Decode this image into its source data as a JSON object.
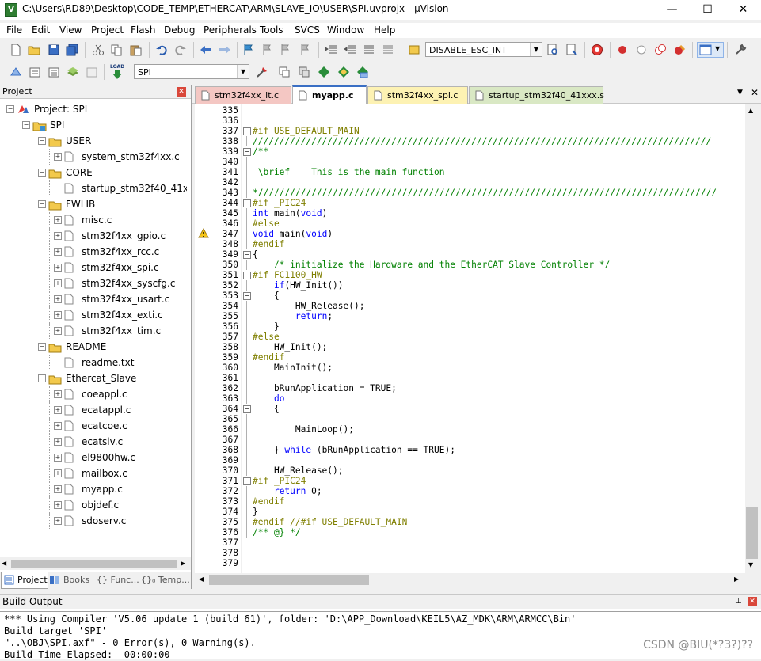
{
  "window": {
    "title": "C:\\Users\\RD89\\Desktop\\CODE_TEMP\\ETHERCAT\\ARM\\SLAVE_IO\\USER\\SPI.uvprojx - µVision",
    "app_icon_letter": "V",
    "controls": {
      "minimize": "—",
      "maximize": "☐",
      "close": "✕"
    }
  },
  "menu": [
    "File",
    "Edit",
    "View",
    "Project",
    "Flash",
    "Debug",
    "Peripherals",
    "Tools",
    "SVCS",
    "Window",
    "Help"
  ],
  "toolbar": {
    "define_combo": "DISABLE_ESC_INT",
    "target_combo": "SPI",
    "load_label": "LOAD"
  },
  "project_panel": {
    "header": "Project",
    "pin": "📌",
    "close": "✕",
    "tree": [
      {
        "label": "Project: SPI",
        "level": 0,
        "kind": "project",
        "exp": "−"
      },
      {
        "label": "SPI",
        "level": 1,
        "kind": "target",
        "exp": "−"
      },
      {
        "label": "USER",
        "level": 2,
        "kind": "folder",
        "exp": "−"
      },
      {
        "label": "system_stm32f4xx.c",
        "level": 3,
        "kind": "file",
        "exp": "+"
      },
      {
        "label": "CORE",
        "level": 2,
        "kind": "folder",
        "exp": "−"
      },
      {
        "label": "startup_stm32f40_41xxx.s",
        "level": 3,
        "kind": "file",
        "exp": ""
      },
      {
        "label": "FWLIB",
        "level": 2,
        "kind": "folder",
        "exp": "−"
      },
      {
        "label": "misc.c",
        "level": 3,
        "kind": "file",
        "exp": "+"
      },
      {
        "label": "stm32f4xx_gpio.c",
        "level": 3,
        "kind": "file",
        "exp": "+"
      },
      {
        "label": "stm32f4xx_rcc.c",
        "level": 3,
        "kind": "file",
        "exp": "+"
      },
      {
        "label": "stm32f4xx_spi.c",
        "level": 3,
        "kind": "file",
        "exp": "+"
      },
      {
        "label": "stm32f4xx_syscfg.c",
        "level": 3,
        "kind": "file",
        "exp": "+"
      },
      {
        "label": "stm32f4xx_usart.c",
        "level": 3,
        "kind": "file",
        "exp": "+"
      },
      {
        "label": "stm32f4xx_exti.c",
        "level": 3,
        "kind": "file",
        "exp": "+"
      },
      {
        "label": "stm32f4xx_tim.c",
        "level": 3,
        "kind": "file",
        "exp": "+"
      },
      {
        "label": "README",
        "level": 2,
        "kind": "folder",
        "exp": "−"
      },
      {
        "label": "readme.txt",
        "level": 3,
        "kind": "file",
        "exp": ""
      },
      {
        "label": "Ethercat_Slave",
        "level": 2,
        "kind": "folder",
        "exp": "−"
      },
      {
        "label": "coeappl.c",
        "level": 3,
        "kind": "file",
        "exp": "+"
      },
      {
        "label": "ecatappl.c",
        "level": 3,
        "kind": "file",
        "exp": "+"
      },
      {
        "label": "ecatcoe.c",
        "level": 3,
        "kind": "file",
        "exp": "+"
      },
      {
        "label": "ecatslv.c",
        "level": 3,
        "kind": "file",
        "exp": "+"
      },
      {
        "label": "el9800hw.c",
        "level": 3,
        "kind": "file",
        "exp": "+"
      },
      {
        "label": "mailbox.c",
        "level": 3,
        "kind": "file",
        "exp": "+"
      },
      {
        "label": "myapp.c",
        "level": 3,
        "kind": "file",
        "exp": "+"
      },
      {
        "label": "objdef.c",
        "level": 3,
        "kind": "file",
        "exp": "+"
      },
      {
        "label": "sdoserv.c",
        "level": 3,
        "kind": "file",
        "exp": "+"
      }
    ],
    "bottom_tabs": [
      "Project",
      "Books",
      "{} Func...",
      "{}₀ Temp..."
    ]
  },
  "editor": {
    "tabs": [
      {
        "label": "stm32f4xx_it.c",
        "color": "#f4c7c3",
        "active": false
      },
      {
        "label": "myapp.c",
        "color": "#ffffff",
        "active": true
      },
      {
        "label": "stm32f4xx_spi.c",
        "color": "#fdf2b3",
        "active": false
      },
      {
        "label": "startup_stm32f40_41xxx.s",
        "color": "#d9e8c4",
        "active": false
      }
    ],
    "first_line": 335,
    "warning_line": 347,
    "lines": [
      {
        "n": "335",
        "fold": "",
        "spans": []
      },
      {
        "n": "336",
        "fold": "",
        "spans": []
      },
      {
        "n": "337",
        "fold": "−",
        "spans": [
          [
            "pp",
            "#if USE_DEFAULT_MAIN"
          ]
        ]
      },
      {
        "n": "338",
        "fold": "",
        "spans": [
          [
            "cm",
            "//////////////////////////////////////////////////////////////////////////////////////"
          ]
        ]
      },
      {
        "n": "339",
        "fold": "−",
        "spans": [
          [
            "cm",
            "/**"
          ]
        ]
      },
      {
        "n": "340",
        "fold": "",
        "spans": []
      },
      {
        "n": "341",
        "fold": "",
        "spans": [
          [
            "cm",
            " \\brief    This is the main function"
          ]
        ]
      },
      {
        "n": "342",
        "fold": "",
        "spans": []
      },
      {
        "n": "343",
        "fold": "",
        "spans": [
          [
            "cm",
            "*//////////////////////////////////////////////////////////////////////////////////////"
          ]
        ]
      },
      {
        "n": "344",
        "fold": "−",
        "spans": [
          [
            "pp",
            "#if _PIC24"
          ]
        ]
      },
      {
        "n": "345",
        "fold": "",
        "spans": [
          [
            "kw",
            "int"
          ],
          [
            "brk",
            " main("
          ],
          [
            "kw",
            "void"
          ],
          [
            "brk",
            ")"
          ]
        ]
      },
      {
        "n": "346",
        "fold": "",
        "spans": [
          [
            "pp",
            "#else"
          ]
        ]
      },
      {
        "n": "347",
        "fold": "",
        "spans": [
          [
            "kw",
            "void"
          ],
          [
            "brk",
            " main("
          ],
          [
            "kw",
            "void"
          ],
          [
            "brk",
            ")"
          ]
        ]
      },
      {
        "n": "348",
        "fold": "",
        "spans": [
          [
            "pp",
            "#endif"
          ]
        ]
      },
      {
        "n": "349",
        "fold": "−",
        "spans": [
          [
            "brk",
            "{"
          ]
        ]
      },
      {
        "n": "350",
        "fold": "",
        "spans": [
          [
            "cm",
            "    /* initialize the Hardware and the EtherCAT Slave Controller */"
          ]
        ]
      },
      {
        "n": "351",
        "fold": "−",
        "spans": [
          [
            "pp",
            "#if FC1100_HW"
          ]
        ]
      },
      {
        "n": "352",
        "fold": "",
        "spans": [
          [
            "brk",
            "    "
          ],
          [
            "kw",
            "if"
          ],
          [
            "brk",
            "(HW_Init())"
          ]
        ]
      },
      {
        "n": "353",
        "fold": "−",
        "spans": [
          [
            "brk",
            "    {"
          ]
        ]
      },
      {
        "n": "354",
        "fold": "",
        "spans": [
          [
            "brk",
            "        HW_Release();"
          ]
        ]
      },
      {
        "n": "355",
        "fold": "",
        "spans": [
          [
            "brk",
            "        "
          ],
          [
            "kw",
            "return"
          ],
          [
            "brk",
            ";"
          ]
        ]
      },
      {
        "n": "356",
        "fold": "",
        "spans": [
          [
            "brk",
            "    }"
          ]
        ]
      },
      {
        "n": "357",
        "fold": "",
        "spans": [
          [
            "pp",
            "#else"
          ]
        ]
      },
      {
        "n": "358",
        "fold": "",
        "spans": [
          [
            "brk",
            "    HW_Init();"
          ]
        ]
      },
      {
        "n": "359",
        "fold": "",
        "spans": [
          [
            "pp",
            "#endif"
          ]
        ]
      },
      {
        "n": "360",
        "fold": "",
        "spans": [
          [
            "brk",
            "    MainInit();"
          ]
        ]
      },
      {
        "n": "361",
        "fold": "",
        "spans": []
      },
      {
        "n": "362",
        "fold": "",
        "spans": [
          [
            "brk",
            "    bRunApplication = TRUE;"
          ]
        ]
      },
      {
        "n": "363",
        "fold": "",
        "spans": [
          [
            "brk",
            "    "
          ],
          [
            "kw",
            "do"
          ]
        ]
      },
      {
        "n": "364",
        "fold": "−",
        "spans": [
          [
            "brk",
            "    {"
          ]
        ]
      },
      {
        "n": "365",
        "fold": "",
        "spans": []
      },
      {
        "n": "366",
        "fold": "",
        "spans": [
          [
            "brk",
            "        MainLoop();"
          ]
        ]
      },
      {
        "n": "367",
        "fold": "",
        "spans": []
      },
      {
        "n": "368",
        "fold": "",
        "spans": [
          [
            "brk",
            "    } "
          ],
          [
            "kw",
            "while"
          ],
          [
            "brk",
            " (bRunApplication == TRUE);"
          ]
        ]
      },
      {
        "n": "369",
        "fold": "",
        "spans": []
      },
      {
        "n": "370",
        "fold": "",
        "spans": [
          [
            "brk",
            "    HW_Release();"
          ]
        ]
      },
      {
        "n": "371",
        "fold": "−",
        "spans": [
          [
            "pp",
            "#if _PIC24"
          ]
        ]
      },
      {
        "n": "372",
        "fold": "",
        "spans": [
          [
            "brk",
            "    "
          ],
          [
            "kw",
            "return"
          ],
          [
            "brk",
            " 0;"
          ]
        ]
      },
      {
        "n": "373",
        "fold": "",
        "spans": [
          [
            "pp",
            "#endif"
          ]
        ]
      },
      {
        "n": "374",
        "fold": "",
        "spans": [
          [
            "brk",
            "}"
          ]
        ]
      },
      {
        "n": "375",
        "fold": "",
        "spans": [
          [
            "pp",
            "#endif //#if USE_DEFAULT_MAIN"
          ]
        ]
      },
      {
        "n": "376",
        "fold": "",
        "spans": [
          [
            "cm",
            "/** @} */"
          ]
        ]
      },
      {
        "n": "377",
        "fold": "",
        "spans": []
      },
      {
        "n": "378",
        "fold": "",
        "spans": []
      },
      {
        "n": "379",
        "fold": "",
        "spans": []
      }
    ]
  },
  "build_output": {
    "header": "Build Output",
    "lines": [
      "*** Using Compiler 'V5.06 update 1 (build 61)', folder: 'D:\\APP_Download\\KEIL5\\AZ_MDK\\ARM\\ARMCC\\Bin'",
      "Build target 'SPI'",
      "\"..\\OBJ\\SPI.axf\" - 0 Error(s), 0 Warning(s).",
      "Build Time Elapsed:  00:00:00"
    ]
  },
  "watermark": "CSDN @BIU(*?3?)??",
  "colors": {
    "keyword": "#0000ff",
    "preprocessor": "#7f7f00",
    "comment": "#008000"
  }
}
